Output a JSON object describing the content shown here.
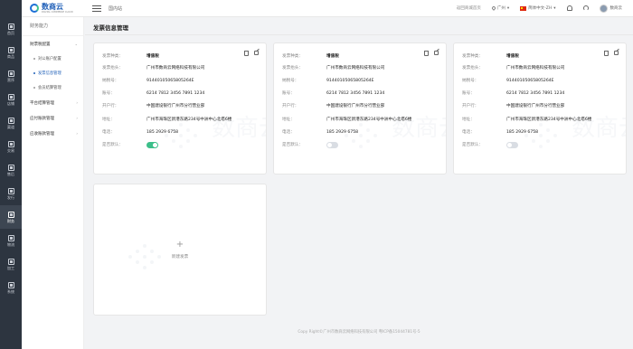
{
  "rail": {
    "items": [
      {
        "label": "首页",
        "icon": "home-icon"
      },
      {
        "label": "商品",
        "icon": "goods-icon"
      },
      {
        "label": "营序",
        "icon": "order-icon"
      },
      {
        "label": "店铺",
        "icon": "shop-icon"
      },
      {
        "label": "渠道",
        "icon": "channel-icon"
      },
      {
        "label": "交易",
        "icon": "trade-icon"
      },
      {
        "label": "售后",
        "icon": "aftersale-icon"
      },
      {
        "label": "发行",
        "icon": "issue-icon"
      },
      {
        "label": "财务",
        "icon": "finance-icon"
      },
      {
        "label": "物流",
        "icon": "logistics-icon"
      },
      {
        "label": "加工",
        "icon": "process-icon"
      },
      {
        "label": "系统",
        "icon": "system-icon"
      }
    ],
    "active_index": 8
  },
  "topbar": {
    "logo_name": "数商云",
    "logo_sub": "DIGITAL COMMERCE CLOUD",
    "title": "国内站",
    "home_link": "返回商城首页",
    "location": "广州",
    "language": "简体中文-ZH",
    "username": "数商云"
  },
  "side": {
    "title": "财务能力",
    "groups": [
      {
        "label": "财票税配置",
        "expanded": true,
        "items": [
          {
            "label": "对公账户配置",
            "active": false
          },
          {
            "label": "发票信息管理",
            "active": true
          },
          {
            "label": "会员结算管理",
            "active": false
          }
        ]
      },
      {
        "label": "平台结算管理",
        "expanded": false,
        "items": []
      },
      {
        "label": "应付账款管理",
        "expanded": false,
        "items": []
      },
      {
        "label": "应收账款管理",
        "expanded": false,
        "items": []
      }
    ]
  },
  "page": {
    "title": "发票信息管理",
    "field_labels": {
      "type": "发票种类：",
      "header": "发票抬头：",
      "tax_id": "纳税号：",
      "account": "账号：",
      "bank": "开户行：",
      "address": "地址：",
      "phone": "电话：",
      "default": "是否默认："
    },
    "cards": [
      {
        "type": "增值税",
        "header": "广州市数商云网络科技有限公司",
        "tax_id": "91440105065805264E",
        "account": "6214 7812 3456 7891 1234",
        "bank": "中国建设银行广州市分行营业部",
        "address": "广州市海珠区新港东路234号中洲中心北塔6楼",
        "phone": "185 2929 6758",
        "is_default": true
      },
      {
        "type": "增值税",
        "header": "广州市数商云网络科技有限公司",
        "tax_id": "91440105065805264E",
        "account": "6214 7812 3456 7891 1234",
        "bank": "中国建设银行广州市分行营业部",
        "address": "广州市海珠区新港东路234号中洲中心北塔6楼",
        "phone": "185 2929 6758",
        "is_default": false
      },
      {
        "type": "增值税",
        "header": "广州市数商云网络科技有限公司",
        "tax_id": "91440105065805264E",
        "account": "6214 7812 3456 7891 1234",
        "bank": "中国建设银行广州市分行营业部",
        "address": "广州市海珠区新港东路234号中洲中心北塔6楼",
        "phone": "185 2929 6758",
        "is_default": false
      }
    ],
    "add_label": "新建发票",
    "watermark": "数商云",
    "footer": "Copy Right©广州市数商云网络科技有限公司 粤ICP备15044781号-5"
  },
  "colors": {
    "rail_bg": "#2d3540",
    "accent": "#1f5fb8",
    "toggle_on": "#3cbf8a"
  }
}
